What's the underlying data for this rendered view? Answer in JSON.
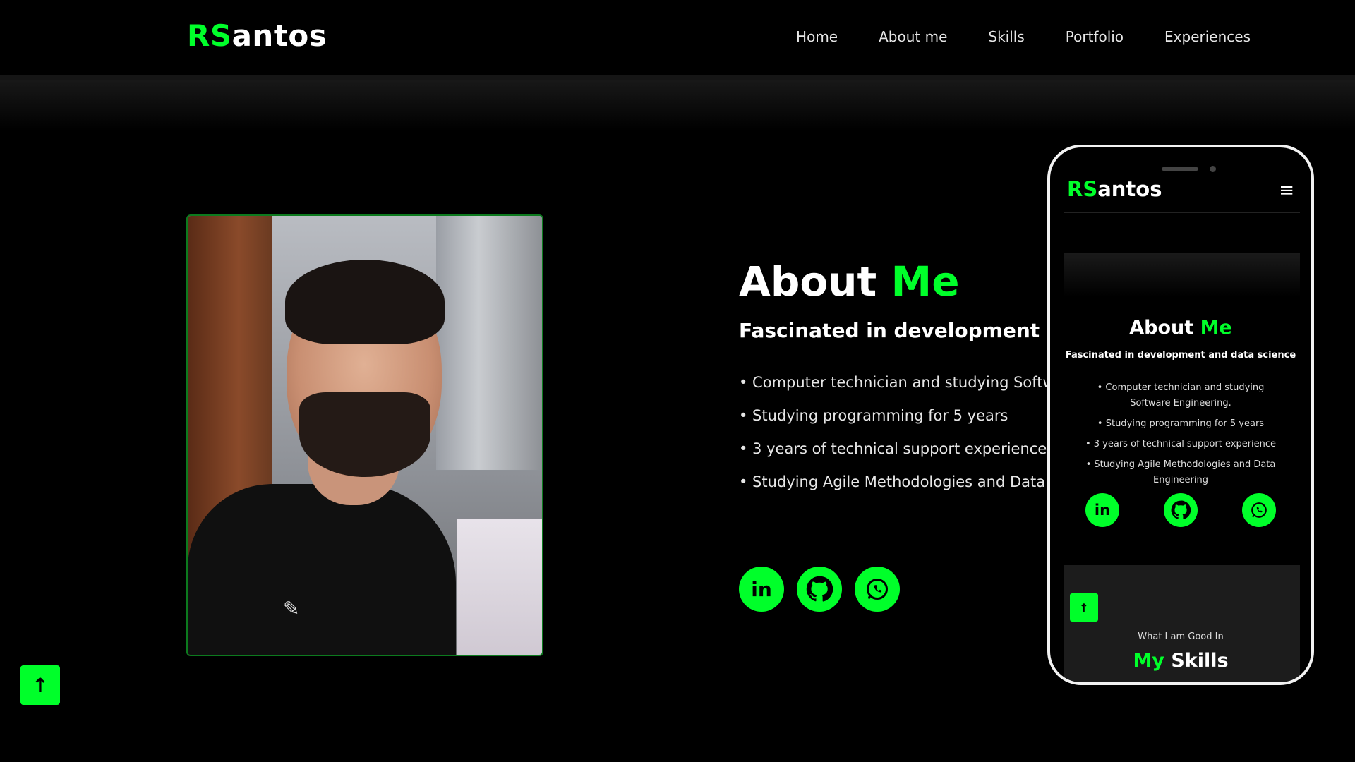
{
  "brand": {
    "logo_accent": "RS",
    "logo_rest": "antos",
    "accent_color": "#00ff2a"
  },
  "nav": {
    "items": [
      "Home",
      "About me",
      "Skills",
      "Portfolio",
      "Experiences"
    ]
  },
  "about": {
    "title_a": "About",
    "title_b": "Me",
    "subtitle": "Fascinated in development an",
    "bullets": [
      "• Computer technician and studying Softw",
      "• Studying programming for 5 years",
      "• 3 years of technical support experience",
      "• Studying Agile Methodologies and Data E"
    ],
    "social_icons": [
      "linkedin-icon",
      "github-icon",
      "whatsapp-icon"
    ]
  },
  "scroll_to_top": {
    "icon": "arrow-up-icon",
    "glyph": "↑"
  },
  "phone": {
    "logo_accent": "RS",
    "logo_rest": "antos",
    "menu_glyph": "≡",
    "title_a": "About",
    "title_b": "Me",
    "subtitle": "Fascinated in development and data science",
    "bullets": [
      "• Computer technician and studying Software Engineering.",
      "• Studying programming for 5 years",
      "• 3 years of technical support experience",
      "• Studying Agile Methodologies and Data Engineering"
    ],
    "skills_sub": "What I am Good In",
    "skills_title_a": "My",
    "skills_title_b": "Skills"
  }
}
